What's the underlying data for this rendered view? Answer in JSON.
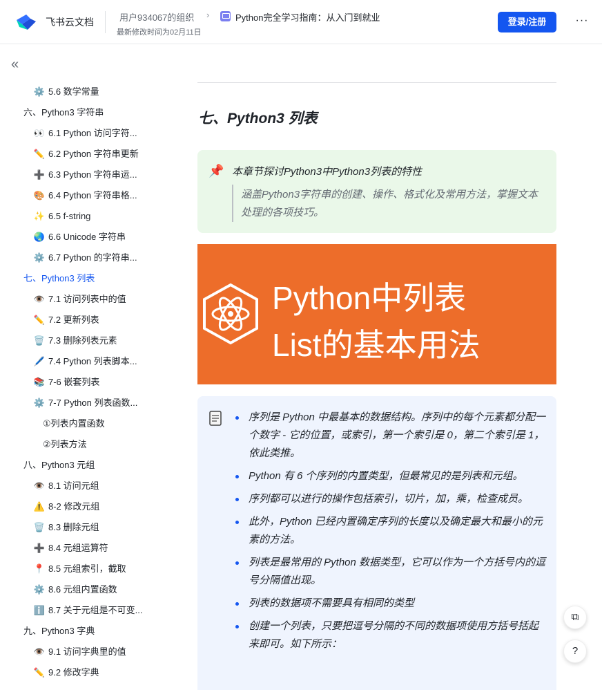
{
  "header": {
    "brand": "飞书云文档",
    "org": "用户934067的组织",
    "arrow": "›",
    "doc_title": "Python完全学习指南：从入门到就业",
    "modified": "最新修改时间为02月11日",
    "login_label": "登录/注册",
    "more_label": "···",
    "accent": "#1456f0"
  },
  "sidebar": {
    "collapse_label": "«",
    "items": [
      {
        "label": "5.6 数学常量",
        "icon": "gear-icon",
        "glyph": "⚙️",
        "level": 2
      },
      {
        "label": "六、Python3 字符串",
        "level": 1
      },
      {
        "label": "6.1 Python 访问字符...",
        "icon": "eyes-icon",
        "glyph": "👀",
        "level": 2
      },
      {
        "label": "6.2 Python 字符串更新",
        "icon": "pencil-icon",
        "glyph": "✏️",
        "level": 2
      },
      {
        "label": "6.3 Python 字符串运...",
        "icon": "plus-icon",
        "glyph": "➕",
        "level": 2
      },
      {
        "label": "6.4 Python 字符串格...",
        "icon": "palette-icon",
        "glyph": "🎨",
        "level": 2
      },
      {
        "label": "6.5 f-string",
        "icon": "sparkles-icon",
        "glyph": "✨",
        "level": 2
      },
      {
        "label": "6.6 Unicode 字符串",
        "icon": "globe-icon",
        "glyph": "🌏",
        "level": 2
      },
      {
        "label": "6.7 Python 的字符串...",
        "icon": "gear-icon",
        "glyph": "⚙️",
        "level": 2
      },
      {
        "label": "七、Python3 列表",
        "level": 1,
        "active": true
      },
      {
        "label": "7.1 访问列表中的值",
        "icon": "eye-icon",
        "glyph": "👁️",
        "level": 2
      },
      {
        "label": "7.2 更新列表",
        "icon": "pencil-icon",
        "glyph": "✏️",
        "level": 2
      },
      {
        "label": "7.3 删除列表元素",
        "icon": "trash-icon",
        "glyph": "🗑️",
        "level": 2
      },
      {
        "label": "7.4 Python 列表脚本...",
        "icon": "script-icon",
        "glyph": "🖊️",
        "level": 2
      },
      {
        "label": "7-6 嵌套列表",
        "icon": "stack-icon",
        "glyph": "📚",
        "level": 2
      },
      {
        "label": "7-7 Python 列表函数...",
        "icon": "gear-icon",
        "glyph": "⚙️",
        "level": 2
      },
      {
        "label": "①列表内置函数",
        "level": 3
      },
      {
        "label": "②列表方法",
        "level": 3
      },
      {
        "label": "八、Python3 元组",
        "level": 1
      },
      {
        "label": "8.1 访问元组",
        "icon": "eye-icon",
        "glyph": "👁️",
        "level": 2
      },
      {
        "label": "8-2 修改元组",
        "icon": "warning-icon",
        "glyph": "⚠️",
        "level": 2
      },
      {
        "label": "8.3 删除元组",
        "icon": "trash-icon",
        "glyph": "🗑️",
        "level": 2
      },
      {
        "label": "8.4 元组运算符",
        "icon": "plus-icon",
        "glyph": "➕",
        "level": 2
      },
      {
        "label": "8.5 元组索引，截取",
        "icon": "pin-icon",
        "glyph": "📍",
        "level": 2
      },
      {
        "label": "8.6 元组内置函数",
        "icon": "gear-icon",
        "glyph": "⚙️",
        "level": 2
      },
      {
        "label": "8.7 关于元组是不可变...",
        "icon": "info-icon",
        "glyph": "ℹ️",
        "level": 2
      },
      {
        "label": "九、Python3 字典",
        "level": 1
      },
      {
        "label": "9.1 访问字典里的值",
        "icon": "eye-icon",
        "glyph": "👁️",
        "level": 2
      },
      {
        "label": "9.2 修改字典",
        "icon": "pencil-icon",
        "glyph": "✏️",
        "level": 2
      }
    ]
  },
  "main": {
    "section_title": "七、Python3 列表",
    "callout_green": {
      "title": "本章节探讨Python3中Python3列表的特性",
      "quote": "涵盖Python3字符串的创建、操作、格式化及常用方法，掌握文本处理的各项技巧。"
    },
    "banner": {
      "line1": "Python中列表",
      "line2": "List的基本用法",
      "bg": "#ed6d2a"
    },
    "bullets": [
      "序列是 Python 中最基本的数据结构。序列中的每个元素都分配一个数字 - 它的位置，或索引，第一个索引是 0，第二个索引是 1，依此类推。",
      "Python 有 6 个序列的内置类型，但最常见的是列表和元组。",
      "序列都可以进行的操作包括索引，切片，加，乘，检查成员。",
      "此外，Python 已经内置确定序列的长度以及确定最大和最小的元素的方法。",
      "列表是最常用的 Python 数据类型，它可以作为一个方括号内的逗号分隔值出现。",
      "列表的数据项不需要具有相同的类型",
      "创建一个列表，只要把逗号分隔的不同的数据项使用方括号括起来即可。如下所示："
    ]
  },
  "floating": {
    "copy_label": "⧉",
    "help_label": "?"
  }
}
